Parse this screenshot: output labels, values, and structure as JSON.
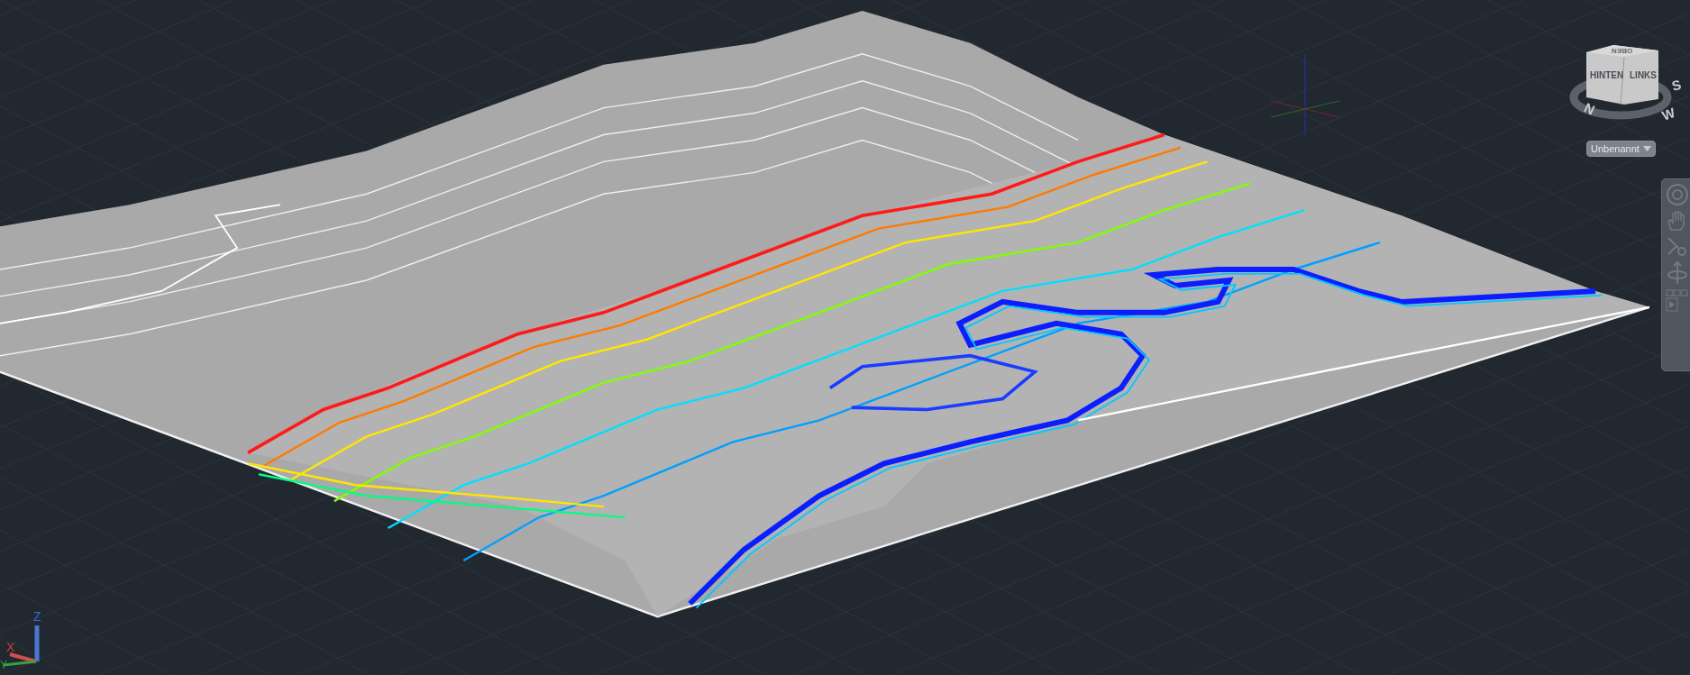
{
  "viewcube": {
    "faces": [
      {
        "kind": "top",
        "label": "OBEN"
      },
      {
        "kind": "front",
        "label": "HINTEN"
      },
      {
        "kind": "side",
        "label": "LINKS"
      }
    ],
    "compass": [
      {
        "kind": "n",
        "label": "N"
      },
      {
        "kind": "w",
        "label": "W"
      },
      {
        "kind": "s",
        "label": "S"
      }
    ]
  },
  "view_menu": {
    "label": "Unbenannt"
  },
  "ucs": {
    "x": "X",
    "y": "Y",
    "z": "Z"
  }
}
